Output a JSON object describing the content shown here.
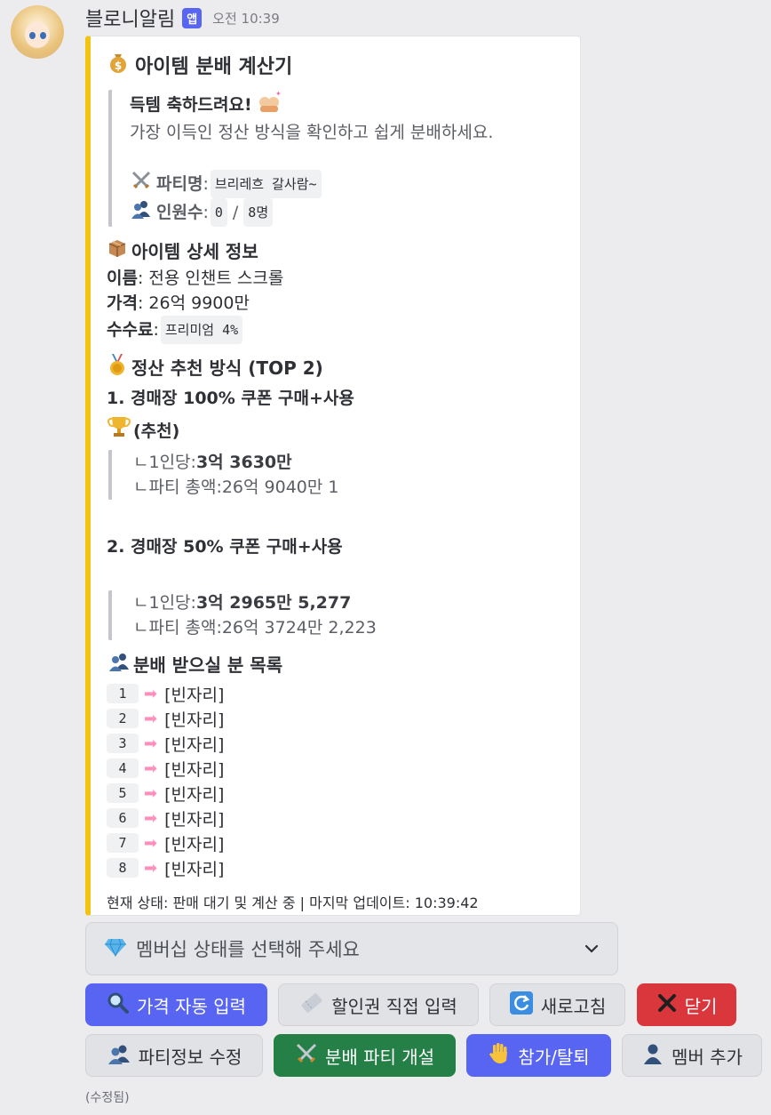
{
  "message": {
    "username": "블로니알림",
    "app_badge": "앱",
    "timestamp": "오전 10:39",
    "edited": "(수정됨)"
  },
  "embed": {
    "accent_color": "#f1c40f",
    "title": "아이템 분배 계산기",
    "title_icon": "money-bag-icon",
    "congrats": "득템 축하드려요!",
    "subtitle": "가장 이득인 정산 방식을 확인하고 쉽게 분배하세요.",
    "party_label": "파티명",
    "party_name": "브리레흐 갈사람~",
    "members_label": "인원수",
    "members_current": "0",
    "members_sep": "/",
    "members_max": "8명",
    "item_section_title": "아이템 상세 정보",
    "name_label": "이름",
    "name_value": ": 전용 인챈트 스크롤",
    "price_label": "가격",
    "price_value": ": 26억 9900만",
    "fee_label": "수수료",
    "fee_value": "프리미엄 4%",
    "method_section_title": "정산 추천 방식 (TOP 2)",
    "methods": [
      {
        "title": "1. 경매장 100% 쿠폰 구매+사용",
        "recommend": "(추천)",
        "per_person_label": "ㄴ1인당: ",
        "per_person_value": "3억 3630만",
        "total_label": "ㄴ파티 총액: ",
        "total_value": "26억 9040만 1"
      },
      {
        "title": "2. 경매장 50% 쿠폰 구매+사용",
        "per_person_label": "ㄴ1인당: ",
        "per_person_value": "3억 2965만 5,277",
        "total_label": "ㄴ파티 총액: ",
        "total_value": "26억 3724만 2,223"
      }
    ],
    "recipients_title": "분배 받으실 분 목록",
    "recipients": [
      {
        "num": "1",
        "name": "[빈자리]"
      },
      {
        "num": "2",
        "name": "[빈자리]"
      },
      {
        "num": "3",
        "name": "[빈자리]"
      },
      {
        "num": "4",
        "name": "[빈자리]"
      },
      {
        "num": "5",
        "name": "[빈자리]"
      },
      {
        "num": "6",
        "name": "[빈자리]"
      },
      {
        "num": "7",
        "name": "[빈자리]"
      },
      {
        "num": "8",
        "name": "[빈자리]"
      }
    ],
    "status": "현재 상태: 판매 대기 및 계산 중 | 마지막 업데이트: 10:39:42"
  },
  "select": {
    "placeholder": "멤버십 상태를 선택해 주세요",
    "icon": "gem-icon"
  },
  "buttons": {
    "auto_price": "가격 자동 입력",
    "coupon_input": "할인권 직접 입력",
    "refresh": "새로고침",
    "close": "닫기",
    "party_edit": "파티정보 수정",
    "open_party": "분배 파티 개설",
    "join_leave": "참가/탈퇴",
    "add_member": "멤버 추가"
  }
}
